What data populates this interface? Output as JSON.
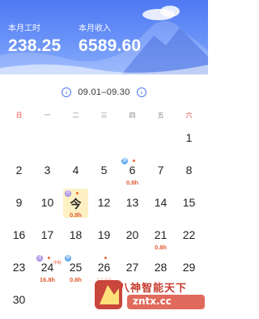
{
  "header": {
    "hours_label": "本月工时",
    "hours_value": "238.25",
    "income_label": "本月收入",
    "income_value": "6589.60"
  },
  "nav": {
    "prev_icon": "chevron-left-icon",
    "next_icon": "chevron-right-icon",
    "prev_glyph": "‹",
    "next_glyph": "›",
    "range": "09.01–09.30"
  },
  "weekdays": [
    "日",
    "一",
    "二",
    "三",
    "四",
    "五",
    "六"
  ],
  "calendar": {
    "rows": [
      [
        {
          "day": ""
        },
        {
          "day": ""
        },
        {
          "day": ""
        },
        {
          "day": ""
        },
        {
          "day": ""
        },
        {
          "day": ""
        },
        {
          "day": "1"
        }
      ],
      [
        {
          "day": "2"
        },
        {
          "day": "3"
        },
        {
          "day": "4"
        },
        {
          "day": "5"
        },
        {
          "day": "6",
          "badge": "休",
          "badge_color": "blue",
          "dot": true,
          "hours": "0.8h"
        },
        {
          "day": "7"
        },
        {
          "day": "8"
        }
      ],
      [
        {
          "day": "9"
        },
        {
          "day": "10"
        },
        {
          "day": "今",
          "badge": "班",
          "badge_color": "purple",
          "dot": true,
          "hours": "0.8h",
          "today": true
        },
        {
          "day": "12"
        },
        {
          "day": "13"
        },
        {
          "day": "14"
        },
        {
          "day": "15"
        }
      ],
      [
        {
          "day": "16"
        },
        {
          "day": "17"
        },
        {
          "day": "18"
        },
        {
          "day": "19"
        },
        {
          "day": "20"
        },
        {
          "day": "21",
          "hours": "0.8h"
        },
        {
          "day": "22"
        }
      ],
      [
        {
          "day": "23"
        },
        {
          "day": "24",
          "badge": "班",
          "badge_color": "purple",
          "dot": true,
          "hours": "16.8h",
          "tiny": "中秋"
        },
        {
          "day": "25",
          "badge": "休",
          "badge_color": "blue",
          "hours": "0.8h"
        },
        {
          "day": "26",
          "dot": true,
          "hours": "12.5h"
        },
        {
          "day": "27"
        },
        {
          "day": "28"
        },
        {
          "day": "29"
        }
      ],
      [
        {
          "day": "30"
        },
        {
          "day": ""
        },
        {
          "day": ""
        },
        {
          "day": ""
        },
        {
          "day": ""
        },
        {
          "day": ""
        },
        {
          "day": ""
        }
      ]
    ]
  },
  "watermark": {
    "text": "八神智能天下",
    "url": "zntx.cc"
  },
  "colors": {
    "accent": "#4f79f2",
    "weekend": "#e4493e",
    "hours": "#e25a32",
    "today_bg": "#fdf1c4"
  }
}
